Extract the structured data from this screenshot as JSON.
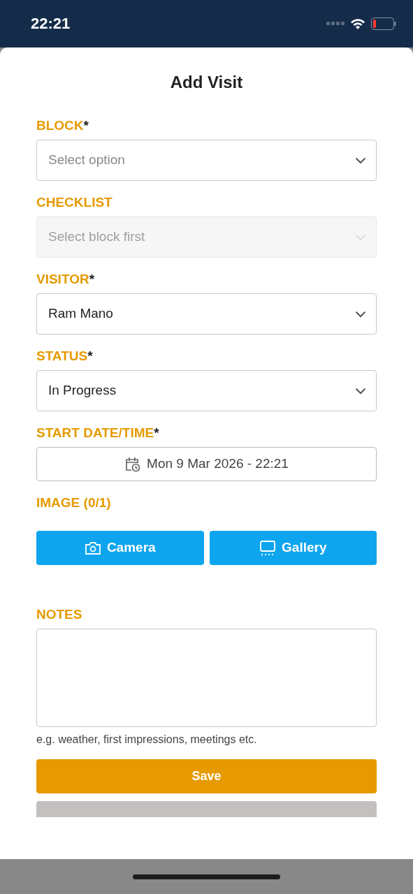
{
  "status_bar": {
    "time": "22:21"
  },
  "title": "Add Visit",
  "fields": [
    {
      "kind": "select",
      "label": "BLOCK",
      "required_mark": "*",
      "placeholder": "Select option",
      "disabled": false
    },
    {
      "kind": "select",
      "label": "CHECKLIST",
      "placeholder": "Select block first",
      "disabled": true
    },
    {
      "kind": "select",
      "label": "VISITOR",
      "required_mark": "*",
      "value": "Ram Mano",
      "disabled": false
    },
    {
      "kind": "select",
      "label": "STATUS",
      "required_mark": "*",
      "value": "In Progress",
      "disabled": false
    },
    {
      "kind": "datetime",
      "label": "START DATE/TIME",
      "required_mark": "*",
      "value": "Mon 9 Mar 2026 - 22:21"
    }
  ],
  "image": {
    "label": "IMAGE (0/1)",
    "buttons": [
      {
        "label": "Camera"
      },
      {
        "label": "Gallery"
      }
    ]
  },
  "notes": {
    "label": "NOTES",
    "hint": "e.g. weather, first impressions, meetings etc."
  },
  "buttons": [
    {
      "kind": "primary",
      "label": "Save"
    },
    {
      "kind": "secondary"
    }
  ]
}
